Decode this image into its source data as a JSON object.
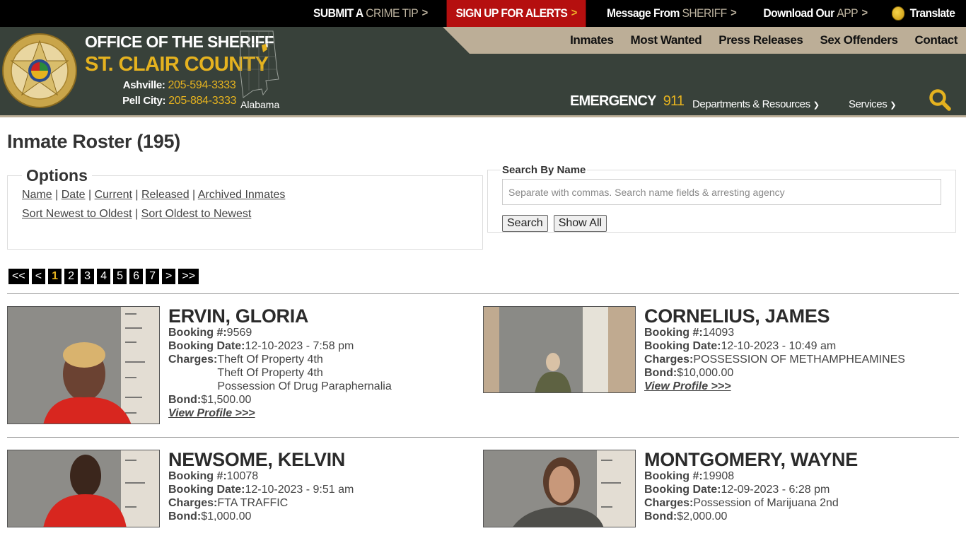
{
  "topbar": {
    "items": [
      {
        "main": "SUBMIT A",
        "muted": "CRIME TIP",
        "chev": ">"
      },
      {
        "main": "SIGN UP FOR ALERTS",
        "muted": "",
        "chev": ">"
      },
      {
        "main": "Message From",
        "muted": "SHERIFF",
        "chev": ">"
      },
      {
        "main": "Download Our",
        "muted": "APP",
        "chev": ">"
      },
      {
        "main": "Translate",
        "muted": "",
        "chev": ""
      }
    ]
  },
  "header": {
    "office": "OFFICE OF THE SHERIFF",
    "county": "ST. CLAIR COUNTY",
    "phones": [
      {
        "label": "Ashville:",
        "number": "205-594-3333"
      },
      {
        "label": "Pell City:",
        "number": "205-884-3333"
      }
    ],
    "map_label": "Alabama",
    "emergency_label": "EMERGENCY",
    "emergency_number": "911",
    "nav": [
      "Inmates",
      "Most Wanted",
      "Press Releases",
      "Sex Offenders",
      "Contact"
    ],
    "dropdowns": [
      "Departments & Resources",
      "Services"
    ],
    "colors": {
      "dark": "#38413a",
      "tan": "#bcae97",
      "gold": "#e5b21f",
      "alert_red": "#b50f0f"
    }
  },
  "page": {
    "title": "Inmate Roster (195)",
    "options": {
      "legend": "Options",
      "filters": [
        "Name",
        "Date",
        "Current",
        "Released",
        "Archived Inmates"
      ],
      "sorts": [
        "Sort Newest to Oldest",
        "Sort Oldest to Newest"
      ]
    },
    "search": {
      "legend": "Search By Name",
      "placeholder": "Separate with commas. Search name fields & arresting agency",
      "value": "",
      "search_label": "Search",
      "show_all_label": "Show All"
    },
    "pager": {
      "first": "<<",
      "prev": "<",
      "pages": [
        "1",
        "2",
        "3",
        "4",
        "5",
        "6",
        "7"
      ],
      "current": "1",
      "next": ">",
      "last": ">>"
    },
    "labels": {
      "booking_no": "Booking #:",
      "booking_date": "Booking Date:",
      "charges": "Charges:",
      "bond": "Bond:",
      "view_profile": "View Profile >>>"
    },
    "inmates": [
      {
        "name": "ERVIN, GLORIA",
        "booking_no": "9569",
        "booking_date": "12-10-2023 - 7:58 pm",
        "charges": [
          "Theft Of Property 4th",
          "Theft Of Property 4th",
          "Possession Of Drug Paraphernalia"
        ],
        "bond": "$1,500.00"
      },
      {
        "name": "CORNELIUS, JAMES",
        "booking_no": "14093",
        "booking_date": "12-10-2023 - 10:49 am",
        "charges": [
          "POSSESSION OF METHAMPHEAMINES"
        ],
        "bond": "$10,000.00"
      },
      {
        "name": "NEWSOME, KELVIN",
        "booking_no": "10078",
        "booking_date": "12-10-2023 - 9:51 am",
        "charges": [
          "FTA TRAFFIC"
        ],
        "bond": "$1,000.00"
      },
      {
        "name": "MONTGOMERY, WAYNE",
        "booking_no": "19908",
        "booking_date": "12-09-2023 - 6:28 pm",
        "charges": [
          "Possession of Marijuana 2nd"
        ],
        "bond": "$2,000.00"
      }
    ]
  }
}
